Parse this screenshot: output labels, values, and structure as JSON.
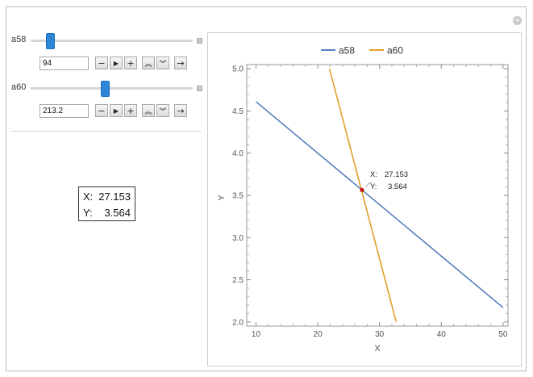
{
  "controls": {
    "sliders": [
      {
        "label": "a58",
        "value": "94"
      },
      {
        "label": "a60",
        "value": "213.2"
      }
    ]
  },
  "readout": {
    "x_label": "X:",
    "x_value": "27.153",
    "y_label": "Y:",
    "y_value": "3.564"
  },
  "chart_data": {
    "type": "line",
    "xlabel": "X",
    "ylabel": "Y",
    "xlim": [
      8.5,
      50.8
    ],
    "ylim": [
      1.95,
      5.05
    ],
    "x_ticks": [
      10,
      20,
      30,
      40,
      50
    ],
    "y_ticks": [
      2.0,
      2.5,
      3.0,
      3.5,
      4.0,
      4.5,
      5.0
    ],
    "x_tick_labels": [
      "10",
      "20",
      "30",
      "40",
      "50"
    ],
    "y_tick_labels": [
      "2.0",
      "2.5",
      "3.0",
      "3.5",
      "4.0",
      "4.5",
      "5.0"
    ],
    "legend_position": "top",
    "series": [
      {
        "name": "a58",
        "color": "#5b7fbf",
        "x": [
          10,
          50
        ],
        "y": [
          4.61,
          2.17
        ]
      },
      {
        "name": "a60",
        "color": "#e0a02a",
        "x": [
          21.9,
          32.7
        ],
        "y": [
          5.0,
          2.0
        ]
      }
    ],
    "intersection": {
      "x": 27.153,
      "y": 3.564,
      "color": "#cc1111"
    },
    "annotation": {
      "x_label": "X:",
      "x_value": "27.153",
      "y_label": "Y:",
      "y_value": "3.564"
    }
  }
}
